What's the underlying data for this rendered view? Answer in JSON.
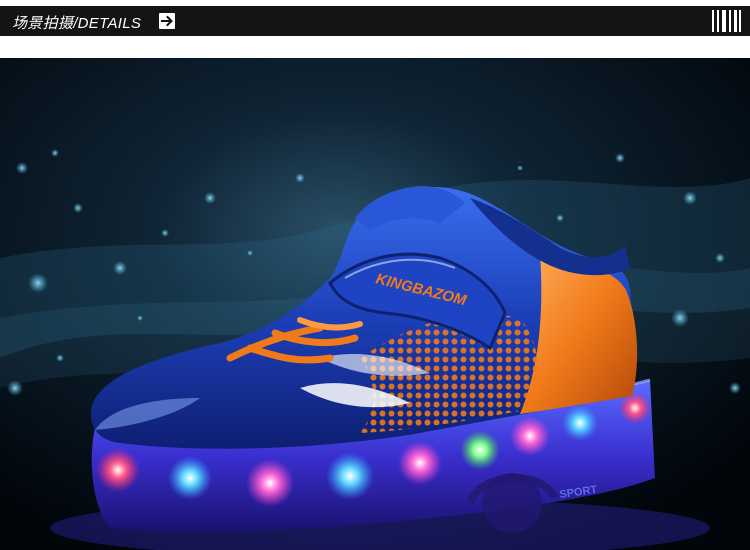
{
  "header": {
    "title": "场景拍摄/DETAILS",
    "arrow_icon": "arrow-right-icon",
    "stripes_icon": "barcode-stripes-icon"
  },
  "scene": {
    "brand_text": "KINGBAZOM",
    "sole_text": "SPORT",
    "colors": {
      "shoe_blue": "#1c3fb8",
      "accent_orange": "#f07a1a",
      "background": "#020a12",
      "sole_glow": "#7a3cff"
    }
  }
}
